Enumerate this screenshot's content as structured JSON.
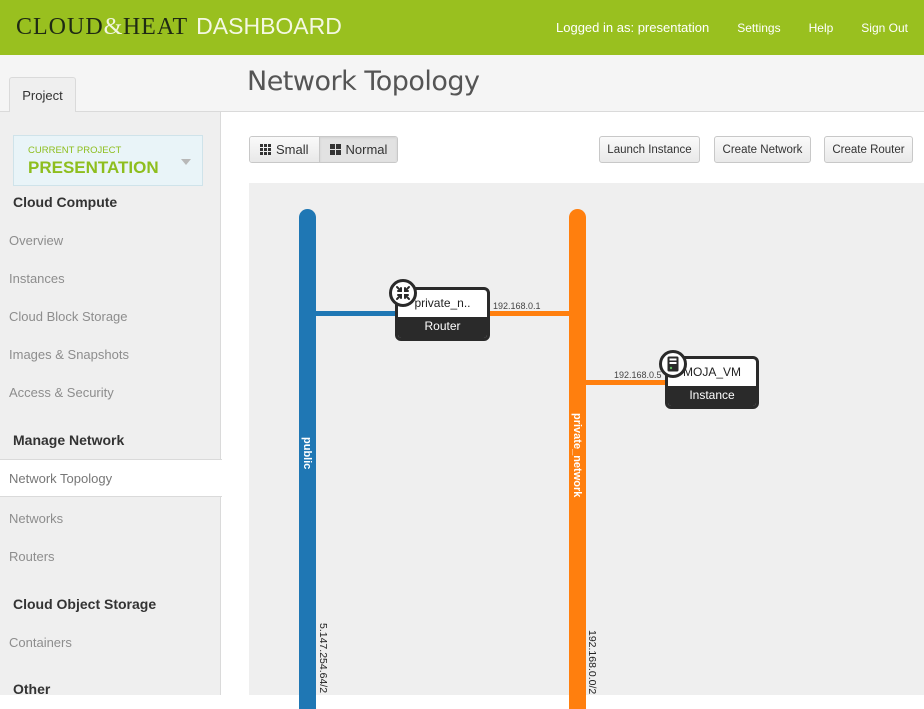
{
  "topbar": {
    "brand_part1": "CLOUD",
    "brand_amp": "&",
    "brand_part2": "HEAT",
    "brand_suffix": "DASHBOARD",
    "logged_in": "Logged in as: presentation",
    "links": [
      "Settings",
      "Help",
      "Sign Out"
    ],
    "color": "#99c01f"
  },
  "tabs": {
    "project": "Project"
  },
  "page": {
    "title": "Network Topology"
  },
  "sidebar": {
    "project_label": "CURRENT PROJECT",
    "project_value": "PRESENTATION",
    "sections": [
      {
        "title": "Cloud Compute",
        "items": [
          "Overview",
          "Instances",
          "Cloud Block Storage",
          "Images & Snapshots",
          "Access & Security"
        ]
      },
      {
        "title": "Manage Network",
        "items": [
          "Network Topology",
          "Networks",
          "Routers"
        ],
        "active": "Network Topology"
      },
      {
        "title": "Cloud Object Storage",
        "items": [
          "Containers"
        ]
      },
      {
        "title": "Other",
        "items": []
      }
    ]
  },
  "toolbar": {
    "view_small": "Small",
    "view_normal": "Normal",
    "view_selected": "Normal",
    "launch_instance": "Launch Instance",
    "create_network": "Create Network",
    "create_router": "Create Router"
  },
  "topology": {
    "networks": [
      {
        "name": "public",
        "cidr": "5.147.254.64/2",
        "color": "#1f77b4"
      },
      {
        "name": "private_network",
        "cidr": "192.168.0.0/2",
        "color": "#ff7f0e"
      }
    ],
    "router": {
      "name": "private_n..",
      "type": "Router",
      "ip": "192.168.0.1"
    },
    "instance": {
      "name": "MOJA_VM",
      "type": "Instance",
      "ip": "192.168.0.5"
    }
  }
}
